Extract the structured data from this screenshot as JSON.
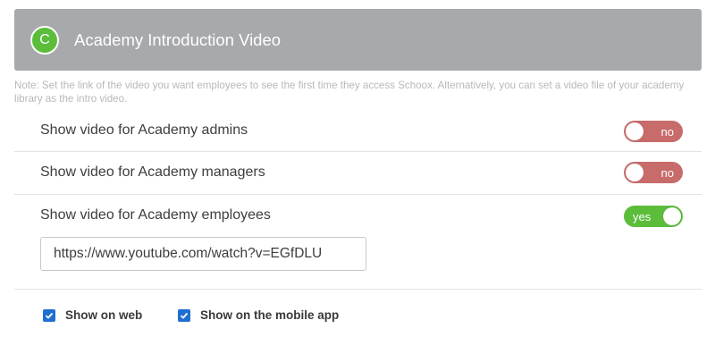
{
  "header": {
    "badge_letter": "C",
    "title": "Academy Introduction Video",
    "badge_color": "#5bbd3a"
  },
  "note": "Note: Set the link of the video you want employees to see the first time they access Schoox. Alternatively, you can set a video file of your academy library as the intro video.",
  "settings": [
    {
      "label": "Show video for Academy admins",
      "toggle": "no",
      "on": false
    },
    {
      "label": "Show video for Academy managers",
      "toggle": "no",
      "on": false
    },
    {
      "label": "Show video for Academy employees",
      "toggle": "yes",
      "on": true
    }
  ],
  "video_url": {
    "value": "https://www.youtube.com/watch?v=EGfDLU"
  },
  "checkboxes": [
    {
      "label": "Show on web",
      "checked": true
    },
    {
      "label": "Show on the mobile app",
      "checked": true
    }
  ],
  "colors": {
    "toggle_off": "#c76b6b",
    "toggle_on": "#5bbd3a",
    "checkbox": "#1f6fd1"
  }
}
